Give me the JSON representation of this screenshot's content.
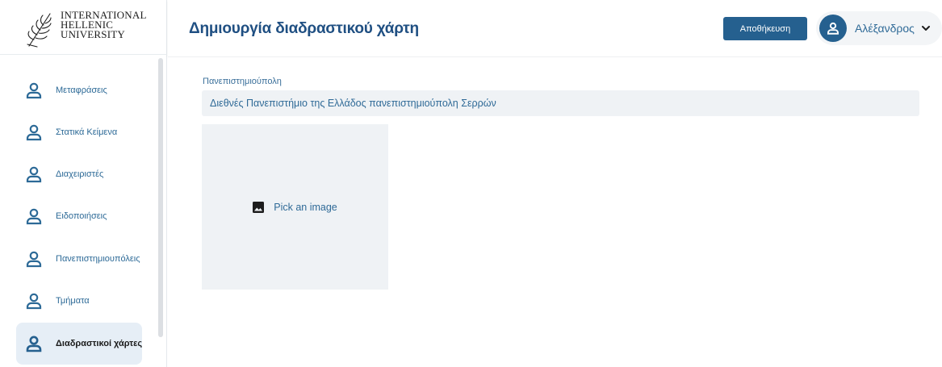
{
  "logo": {
    "line1": "INTERNATIONAL",
    "line2": "HELLENIC",
    "line3": "UNIVERSITY"
  },
  "sidebar": {
    "items": [
      {
        "label": "Μεταφράσεις",
        "icon": "user-icon",
        "active": false
      },
      {
        "label": "Στατικά Κείμενα",
        "icon": "user-icon",
        "active": false
      },
      {
        "label": "Διαχειριστές",
        "icon": "user-icon",
        "active": false
      },
      {
        "label": "Ειδοποιήσεις",
        "icon": "user-icon",
        "active": false
      },
      {
        "label": "Πανεπιστημιουπόλεις",
        "icon": "user-icon",
        "active": false
      },
      {
        "label": "Τμήματα",
        "icon": "user-icon",
        "active": false
      },
      {
        "label": "Διαδραστικοί χάρτες",
        "icon": "user-icon",
        "active": true
      }
    ]
  },
  "header": {
    "title": "Δημιουργία διαδραστικού χάρτη",
    "save_label": "Αποθήκευση",
    "user_name": "Αλέξανδρος"
  },
  "form": {
    "campus_label": "Πανεπιστημιούπολη",
    "campus_value": "Διεθνές Πανεπιστήμιο της Ελλάδος πανεπιστημιούπολη Σερρών",
    "image_picker_label": "Pick an image"
  },
  "colors": {
    "primary": "#25608f",
    "title": "#1f4f82",
    "link": "#2f6a97",
    "active_bg": "#e6eef6",
    "field_bg": "#eff2f5"
  }
}
